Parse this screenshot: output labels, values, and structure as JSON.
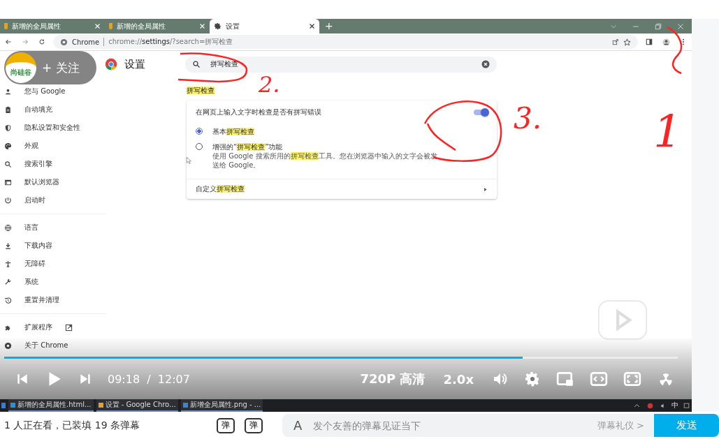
{
  "browser": {
    "tabs": [
      {
        "title": "新增的全局属性",
        "selected": false
      },
      {
        "title": "新增的全局属性",
        "selected": false
      },
      {
        "title": "设置",
        "selected": true
      }
    ],
    "new_tab": "+",
    "address": {
      "chip": "Chrome",
      "url_host": "chrome://",
      "url_path": "settings",
      "url_rest": "/?search=拼写检查"
    }
  },
  "settings": {
    "title": "设置",
    "search": {
      "value": "拼写检查"
    },
    "sidebar": [
      {
        "items": [
          {
            "label": "您与 Google"
          },
          {
            "label": "自动填充"
          },
          {
            "label": "隐私设置和安全性"
          },
          {
            "label": "外观"
          },
          {
            "label": "搜索引擎"
          },
          {
            "label": "默认浏览器"
          },
          {
            "label": "启动时"
          }
        ]
      },
      {
        "items": [
          {
            "label": "语言"
          },
          {
            "label": "下载内容"
          },
          {
            "label": "无障碍"
          },
          {
            "label": "系统"
          },
          {
            "label": "重置并清理"
          }
        ]
      },
      {
        "items": [
          {
            "label": "扩展程序",
            "external": true
          },
          {
            "label": "关于 Chrome",
            "external": false
          }
        ]
      }
    ],
    "section_title": [
      {
        "text": "拼写检查",
        "highlighted": true
      }
    ],
    "card": {
      "toggle": {
        "label": [
          {
            "text": "在网页上输入文字时检查是否有拼写错误",
            "highlighted": false
          }
        ],
        "on": true
      },
      "options": [
        {
          "label": [
            {
              "text": "基本",
              "highlighted": false
            },
            {
              "text": "拼写检查",
              "highlighted": true
            }
          ],
          "selected": true
        },
        {
          "label": [
            {
              "text": "增强的“",
              "highlighted": false
            },
            {
              "text": "拼写检查",
              "highlighted": true
            },
            {
              "text": "”功能",
              "highlighted": false
            }
          ],
          "description": [
            {
              "text": "使用 Google 搜索所用的",
              "highlighted": false
            },
            {
              "text": "拼写检查",
              "highlighted": true
            },
            {
              "text": "工具。您在浏览器中输入的文字会被发送给 Google。",
              "highlighted": false
            }
          ],
          "selected": false
        }
      ],
      "link": [
        {
          "text": "自定义",
          "highlighted": false
        },
        {
          "text": "拼写检查",
          "highlighted": true
        }
      ]
    }
  },
  "overlay": {
    "logo_text": "尚硅谷",
    "follow": "+ 关注"
  },
  "annotations": [
    {
      "text": "2."
    },
    {
      "text": "3."
    },
    {
      "text": "1"
    }
  ],
  "player": {
    "progress": {
      "level": 0.77
    },
    "time_current": "09:18",
    "time_sep": "/",
    "time_total": "12:07",
    "quality": "720P 高清",
    "speed": "2.0x"
  },
  "taskbar": {
    "items": [
      {
        "label": "新增的全局属性.html..."
      },
      {
        "label": "设置 - Google Chro..."
      },
      {
        "label": "新增全局属性.png - ..."
      }
    ],
    "ime": "中"
  },
  "bottom": {
    "viewers": "1 人正在看，已装填 19 条弹幕",
    "danmaku_icons": [
      "弹",
      "弹"
    ],
    "input_icon": "A",
    "placeholder": "发个友善的弹幕见证当下",
    "etiquette": "弹幕礼仪 >",
    "send": "发送"
  }
}
